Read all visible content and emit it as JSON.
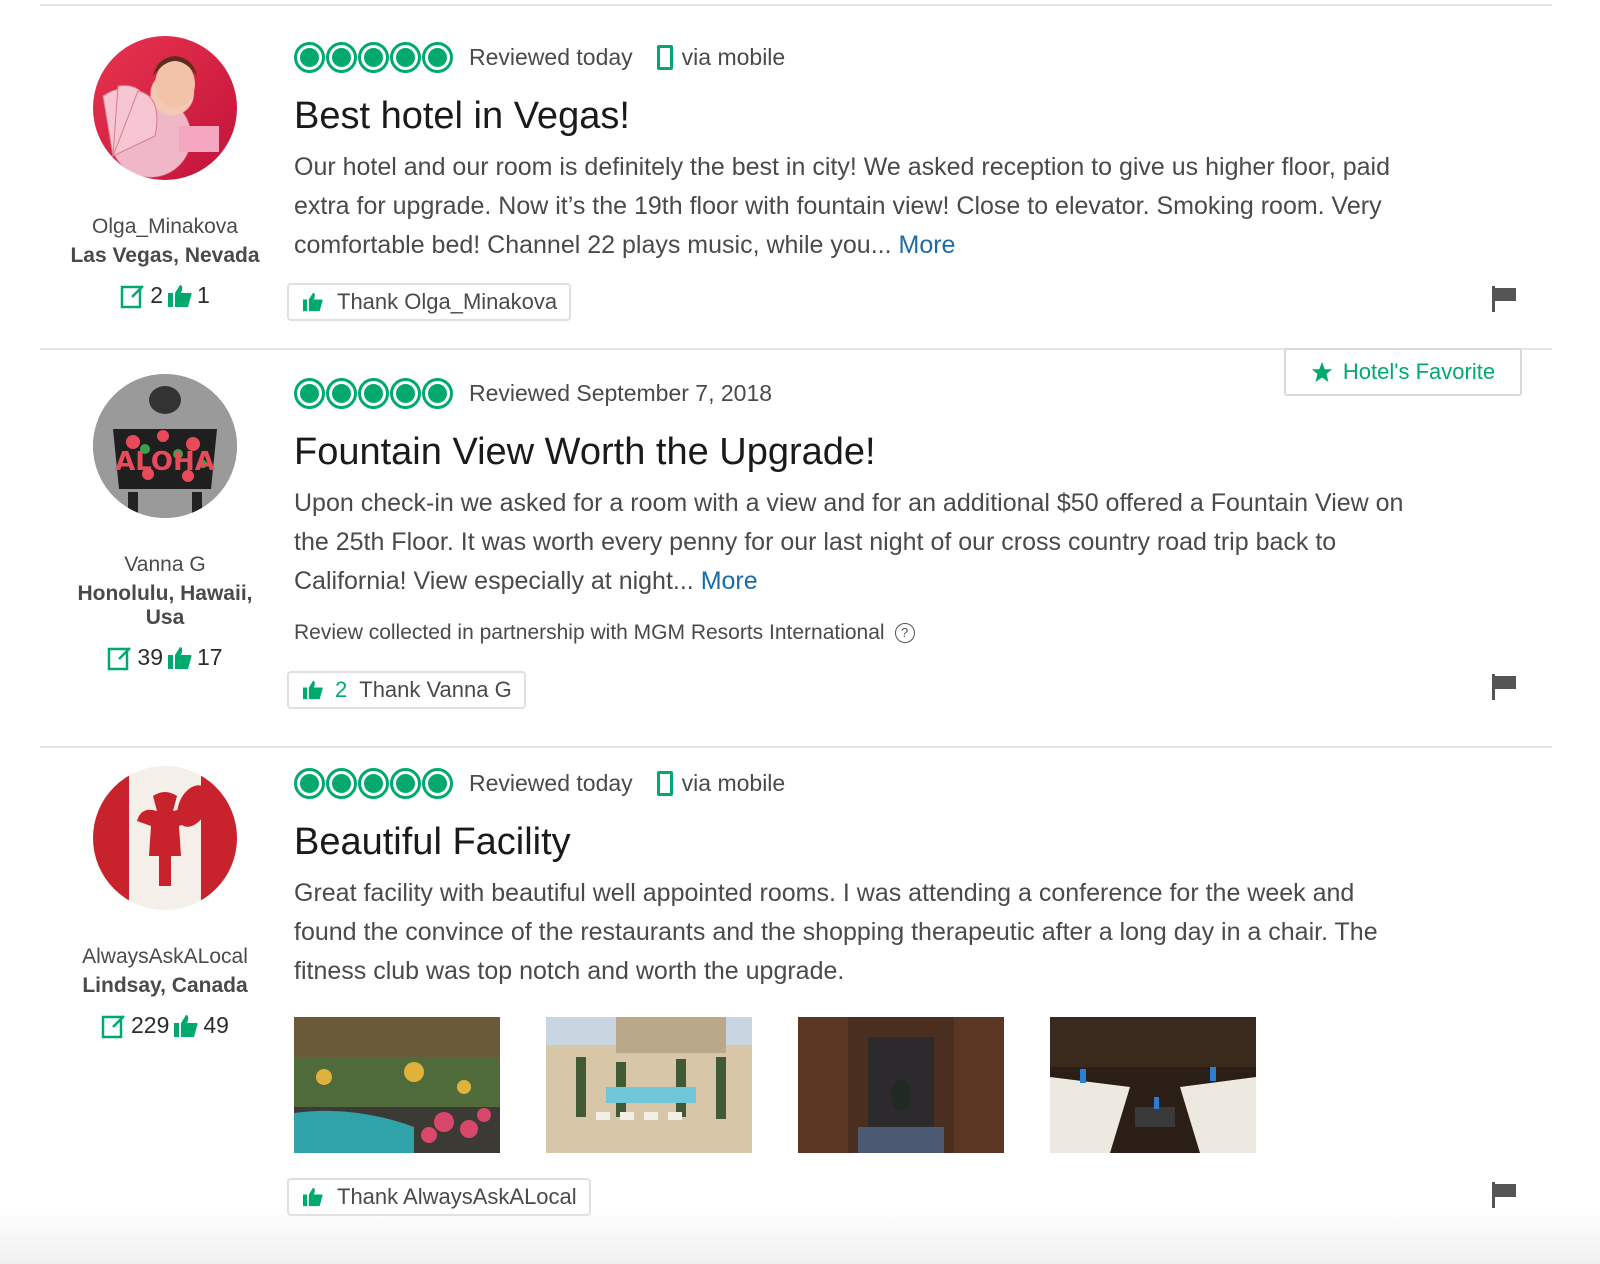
{
  "reviews": [
    {
      "username": "Olga_Minakova",
      "location": "Las Vegas, Nevada",
      "review_count": "2",
      "helpful_count": "1",
      "rating": 5,
      "date": "Reviewed today",
      "via": "via mobile",
      "title": "Best hotel in Vegas!",
      "body": "Our hotel and our room is definitely the best in city! We asked reception to give us higher floor, paid extra for upgrade. Now it’s the 19th floor with fountain view! Close to elevator. Smoking room. Very comfortable bed! Channel 22 plays music, while you...",
      "more": "More",
      "thank_label": "Thank Olga_Minakova",
      "avatar_icon": "user-avatar-woman-fan"
    },
    {
      "username": "Vanna G",
      "location": "Honolulu, Hawaii, Usa",
      "review_count": "39",
      "helpful_count": "17",
      "rating": 5,
      "date": "Reviewed September 7, 2018",
      "badge": "Hotel's Favorite",
      "title": "Fountain View Worth the Upgrade!",
      "body": "Upon check-in we asked for a room with a view and for an additional $50 offered a Fountain View on the 25th Floor. It was worth every penny for our last night of our cross country road trip back to California! View especially at night...",
      "more": "More",
      "partner": "Review collected in partnership with MGM Resorts International",
      "thank_count": "2",
      "thank_label": "Thank Vanna G",
      "avatar_icon": "user-avatar-aloha-cat"
    },
    {
      "username": "AlwaysAskALocal",
      "location": "Lindsay, Canada",
      "review_count": "229",
      "helpful_count": "49",
      "rating": 5,
      "date": "Reviewed today",
      "via": "via mobile",
      "title": "Beautiful Facility",
      "body": "Great facility with beautiful well appointed rooms. I was attending a conference for the week and found the convince of the restaurants and the shopping therapeutic after a long day in a chair. The fitness club was top notch and worth the upgrade.",
      "thank_label": "Thank AlwaysAskALocal",
      "avatar_icon": "user-avatar-canada-flag",
      "photos": [
        "conservatory-garden-photo",
        "pool-terrace-photo",
        "locker-room-photo",
        "vanity-restroom-photo"
      ]
    }
  ],
  "colors": {
    "accent": "#00aa6c",
    "link": "#1a6ba8",
    "title": "#1a1a1a",
    "text": "#4a4a4a",
    "divider": "#e4e4e4"
  }
}
